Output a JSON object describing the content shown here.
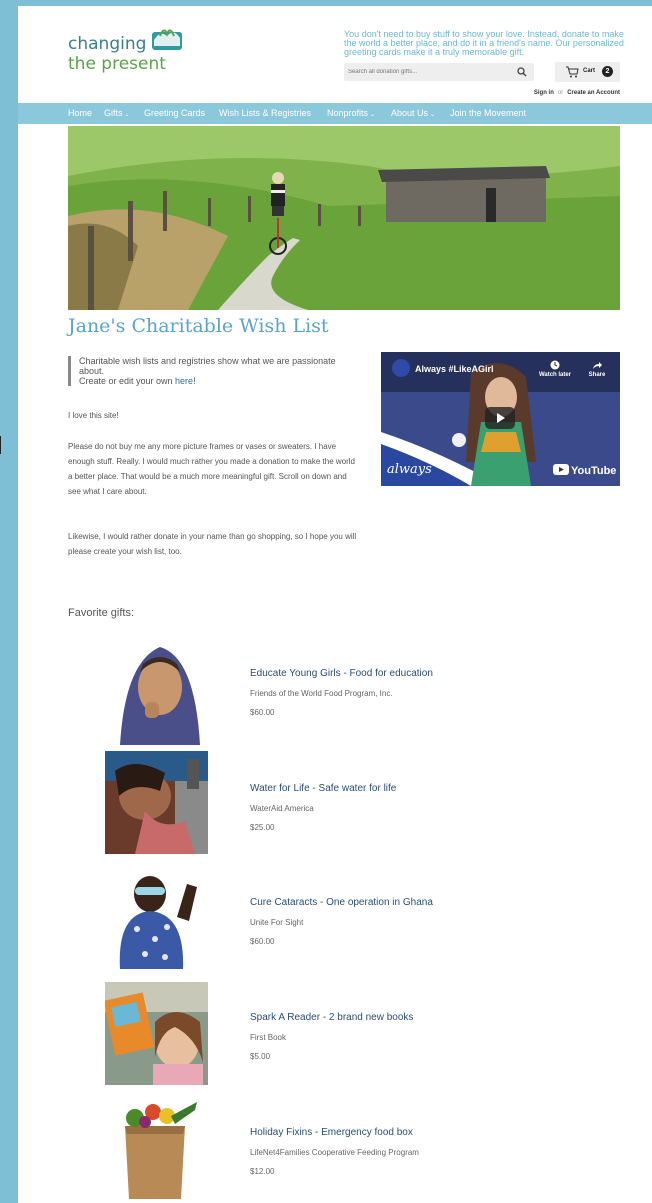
{
  "header": {
    "logo_line1": "changing",
    "logo_line2": "the present",
    "tagline": "You don't need to buy stuff to show your love. Instead, donate to make the world a better place, and do it in a friend's name. Our personalized greeting cards make it a truly memorable gift.",
    "search_placeholder": "Search all donation gifts...",
    "cart_label": "Cart",
    "cart_count": "2",
    "sign_in": "Sign in",
    "or": "or",
    "create_account": "Create an Account"
  },
  "nav": {
    "items": [
      "Home",
      "Gifts",
      "Greeting Cards",
      "Wish Lists & Registries",
      "Nonprofits",
      "About Us",
      "Join the Movement"
    ],
    "caret": "⌄"
  },
  "main": {
    "title": "Jane's Charitable Wish List",
    "quote_text": "Charitable wish lists and registries show what we are passionate about.",
    "quote_line2": "Create or edit your own ",
    "quote_link": "here",
    "quote_end": "!",
    "para1": "I love this site!",
    "para2": "Please do not buy me any more picture frames or vases or sweaters. I have enough stuff. Really. I would much rather you made a donation to make the world a better place. That would be a much more meaningful gift. Scroll on down and see what I care about.",
    "para3": "Likewise, I would rather donate in your name than go shopping, so I hope you will please create your wish list, too."
  },
  "video": {
    "channel": "always",
    "title": "Always #LikeAGirl",
    "watch_later": "Watch later",
    "share": "Share",
    "brand": "always",
    "platform": "YouTube"
  },
  "favorites": {
    "heading": "Favorite gifts:",
    "items": [
      {
        "title": "Educate Young Girls - Food for education",
        "org": "Friends of the World Food Program, Inc.",
        "price": "$60.00"
      },
      {
        "title": "Water for Life - Safe water for life",
        "org": "WaterAid America",
        "price": "$25.00"
      },
      {
        "title": "Cure Cataracts - One operation in Ghana",
        "org": "Unite For Sight",
        "price": "$60.00"
      },
      {
        "title": "Spark A Reader - 2 brand new books",
        "org": "First Book",
        "price": "$5.00"
      },
      {
        "title": "Holiday Fixins - Emergency food box",
        "org": "LifeNet4Families Cooperative Feeding Program",
        "price": "$12.00"
      }
    ]
  },
  "colors": {
    "frame": "#7fbfd6",
    "nav_bar": "#8cc8db",
    "title": "#5aa3c9",
    "link": "#2a4e75"
  }
}
